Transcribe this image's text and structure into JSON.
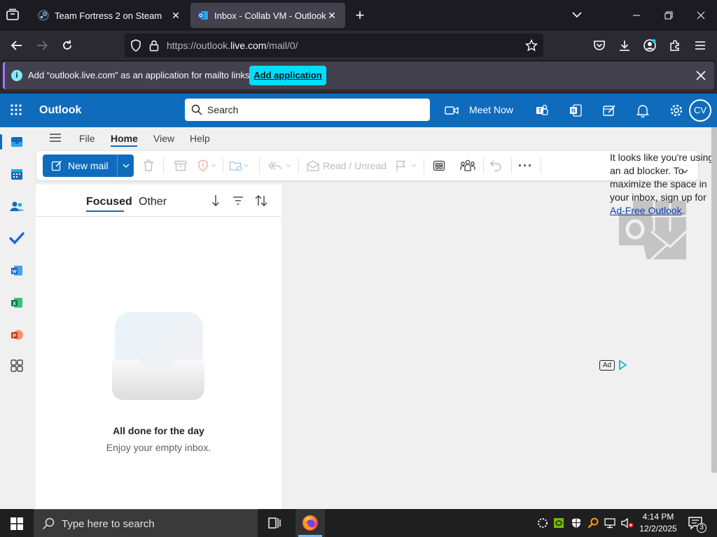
{
  "browser": {
    "tabs": [
      {
        "title": "Team Fortress 2 on Steam",
        "active": false
      },
      {
        "title": "Inbox - Collab VM - Outlook",
        "active": true
      }
    ],
    "url_prefix": "https://outlook.",
    "url_domain": "live.com",
    "url_suffix": "/mail/0/"
  },
  "notification": {
    "message": "Add “outlook.live.com” as an application for mailto links?",
    "button": "Add application"
  },
  "outlook": {
    "brand": "Outlook",
    "search_placeholder": "Search",
    "meet_now": "Meet Now",
    "avatar_initials": "CV",
    "menu_tabs": [
      "File",
      "Home",
      "View",
      "Help"
    ],
    "active_menu_tab": "Home",
    "ribbon": {
      "new_mail": "New mail",
      "read_unread": "Read / Unread"
    },
    "list_tabs": {
      "focused": "Focused",
      "other": "Other"
    },
    "empty_title": "All done for the day",
    "empty_subtitle": "Enjoy your empty inbox.",
    "ad": {
      "text": "It looks like you're using an ad blocker. To maximize the space in your inbox, sign up for",
      "link": "Ad-Free Outlook",
      "end": ".",
      "badge": "Ad"
    }
  },
  "taskbar": {
    "search_placeholder": "Type here to search",
    "time": "4:14 PM",
    "date": "12/2/2025",
    "notification_count": "3"
  },
  "colors": {
    "outlook_blue": "#0f6cbd",
    "firefox_dark": "#1c1b22",
    "notif_button": "#00ddff"
  }
}
